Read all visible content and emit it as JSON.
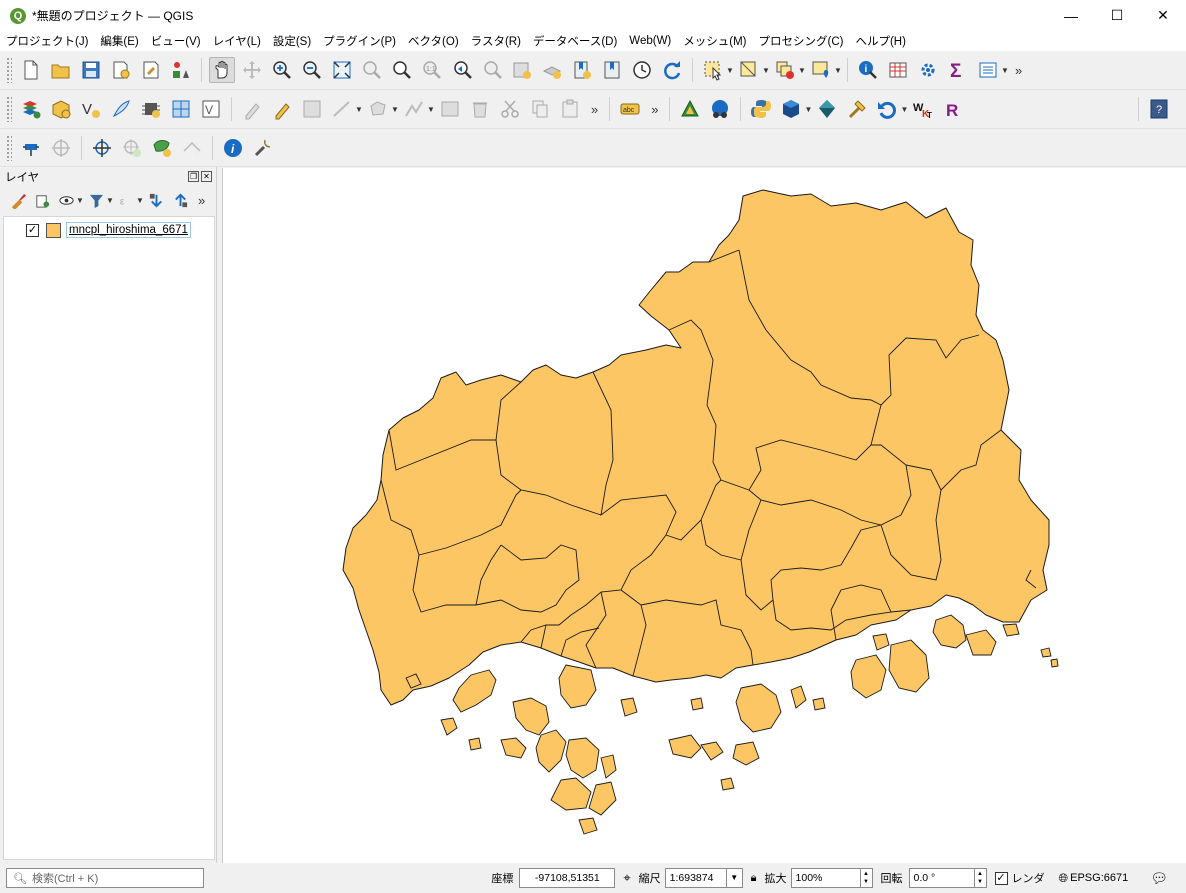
{
  "window": {
    "title": "*無題のプロジェクト — QGIS",
    "app_icon": "qgis-logo-icon",
    "controls": [
      "minimize",
      "maximize",
      "close"
    ]
  },
  "menu": [
    "プロジェクト(J)",
    "編集(E)",
    "ビュー(V)",
    "レイヤ(L)",
    "設定(S)",
    "プラグイン(P)",
    "ベクタ(O)",
    "ラスタ(R)",
    "データベース(D)",
    "Web(W)",
    "メッシュ(M)",
    "プロセシング(C)",
    "ヘルプ(H)"
  ],
  "layers_panel": {
    "title": "レイヤ",
    "layers": [
      {
        "name": "mncpl_hiroshima_6671",
        "checked": true,
        "fill_color": "#fdc665"
      }
    ]
  },
  "map": {
    "fill_color": "#fdc665",
    "stroke_color": "#1a1a1a"
  },
  "status": {
    "search_placeholder": "検索(Ctrl + K)",
    "coord_label": "座標",
    "coord_value": "-97108,51351",
    "scale_label": "縮尺",
    "scale_value": "1:693874",
    "magnifier_label": "拡大",
    "magnifier_value": "100%",
    "rotation_label": "回転",
    "rotation_value": "0.0 °",
    "render_label": "レンダ",
    "crs": "EPSG:6671"
  }
}
